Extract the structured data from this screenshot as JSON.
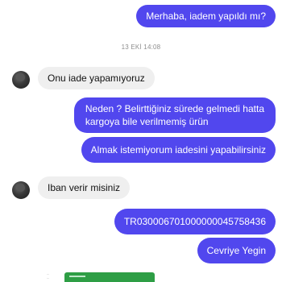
{
  "conversation": {
    "timestamp": "13 EKİ 14:08",
    "messages": [
      {
        "from": "me",
        "text": "Merhaba, iadem yapıldı mı?"
      },
      {
        "from": "them",
        "text": "Onu iade yapamıyoruz"
      },
      {
        "from": "me",
        "lines": [
          "Neden ? Belirttiğiniz sürede gelmedi hatta",
          "kargoya bile verilmemiş ürün"
        ]
      },
      {
        "from": "me",
        "text": "Almak istemiyorum iadesini yapabilirsiniz"
      },
      {
        "from": "them",
        "text": "Iban verir misiniz"
      },
      {
        "from": "me",
        "text": "TR030006701000000045758436"
      },
      {
        "from": "me",
        "text": "Cevriye Yegin"
      }
    ]
  },
  "colors": {
    "outgoing_bubble": "#5147ee",
    "incoming_bubble": "#efefef",
    "attachment_green": "#2e9e45"
  },
  "attachment": {
    "caption_lines": [
      "...",
      "..."
    ]
  }
}
